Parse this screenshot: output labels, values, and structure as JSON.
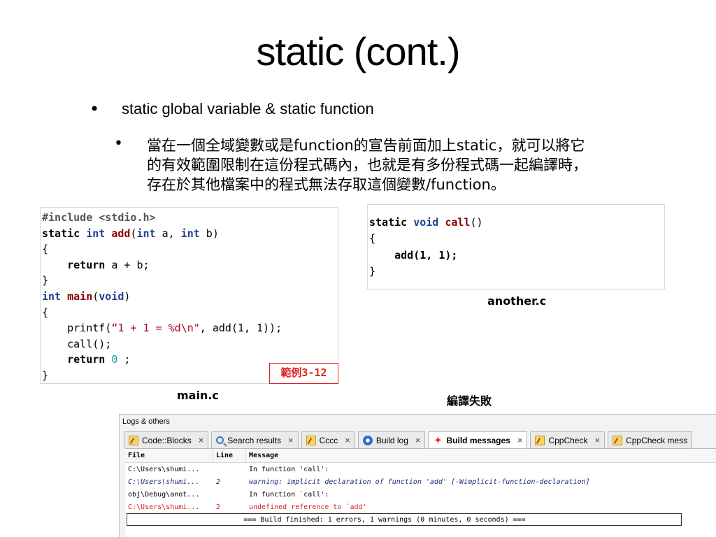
{
  "slide": {
    "title": "static (cont.)",
    "bullet1": "static global variable & static function",
    "bullet2_lines": [
      "當在一個全域變數或是function的宣告前面加上static，就可以將它",
      "的有效範圍限制在這份程式碼內，也就是有多份程式碼一起編譯時，",
      "存在於其他檔案中的程式無法存取這個變數/function。"
    ],
    "bullet_glyph": "•"
  },
  "main_code": {
    "l1": "#include <stdio.h>",
    "l2_static": "static",
    "l2_int": "int",
    "l2_add": "add",
    "l2_args_a": "(",
    "l2_int2": "int",
    "l2_mid": " a, ",
    "l2_int3": "int",
    "l2_end": " b)",
    "l3": "{",
    "l4_ret": "return",
    "l4_rest": " a + b;",
    "l5": "}",
    "l6_int": "int",
    "l6_main": "main",
    "l6_open": "(",
    "l6_void": "void",
    "l6_close": ")",
    "l7": "{",
    "l8_pre": "printf(",
    "l8_str": "“1 + 1 = %d\\n\"",
    "l8_post": ", add(1, 1));",
    "l9": "call();",
    "l10_ret": "return",
    "l10_zero": "0",
    "l10_semi": " ;",
    "l11": "}",
    "example_tag": "範例3-12",
    "caption": "main.c"
  },
  "another_code": {
    "l1_static": "static",
    "l1_void": "void",
    "l1_call": "call",
    "l1_parens": "()",
    "l2": "{",
    "l3": "add(1, 1);",
    "l4": "}",
    "caption": "another.c"
  },
  "fail_caption": "編譯失敗",
  "logs_panel": {
    "title": "Logs & others",
    "tabs": [
      {
        "label": "Code::Blocks",
        "close": "×"
      },
      {
        "label": "Search results",
        "close": "×"
      },
      {
        "label": "Cccc",
        "close": "×"
      },
      {
        "label": "Build log",
        "close": "×"
      },
      {
        "label": "Build messages",
        "close": "×"
      },
      {
        "label": "CppCheck",
        "close": "×"
      },
      {
        "label": "CppCheck mess"
      }
    ],
    "columns": {
      "file": "File",
      "line": "Line",
      "message": "Message"
    },
    "rows": [
      {
        "file": "C:\\Users\\shumi...",
        "line": "",
        "message": "In function 'call':"
      },
      {
        "file": "C:\\Users\\shumi...",
        "line": "2",
        "message": "warning: implicit declaration of function 'add' [-Wimplicit-function-declaration]"
      },
      {
        "file": "obj\\Debug\\anot...",
        "line": "",
        "message": "In function `call':"
      },
      {
        "file": "C:\\Users\\shumi...",
        "line": "2",
        "message": "undefined reference to `add'"
      },
      {
        "file": "",
        "line": "",
        "message": "=== Build finished: 1 errors, 1 warnings (0 minutes, 0 seconds) ==="
      }
    ]
  },
  "colors": {
    "keyword": "#1f3f8f",
    "function_name": "#8b0000",
    "string": "#b00020",
    "number": "#00a0a0",
    "error": "#d21d1d",
    "warning": "#1c2f7a"
  }
}
